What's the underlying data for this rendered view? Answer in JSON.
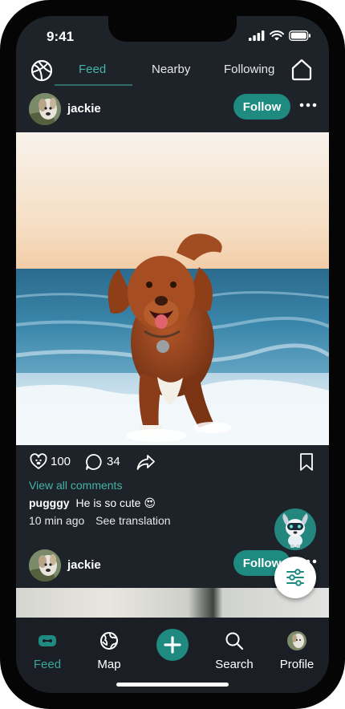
{
  "status": {
    "time": "9:41"
  },
  "tabs": [
    {
      "label": "Feed",
      "active": true
    },
    {
      "label": "Nearby",
      "active": false
    },
    {
      "label": "Following",
      "active": false
    }
  ],
  "post": {
    "username": "jackie",
    "follow_label": "Follow",
    "likes": "100",
    "comments": "34",
    "view_comments": "View all comments",
    "comment_user": "pugggy",
    "comment_text": "He is so cute 😍",
    "time_ago": "10 min ago",
    "translate": "See translation"
  },
  "next_post": {
    "username": "jackie",
    "follow_label": "Follow"
  },
  "bottom_nav": [
    {
      "label": "Feed",
      "icon": "feed-icon",
      "active": true
    },
    {
      "label": "Map",
      "icon": "globe-icon",
      "active": false
    },
    {
      "label": "Search",
      "icon": "search-icon",
      "active": false
    },
    {
      "label": "Profile",
      "icon": "avatar",
      "active": false
    }
  ],
  "colors": {
    "accent": "#1e8a80",
    "accent_text": "#45b3a5",
    "background": "#1e2229"
  }
}
